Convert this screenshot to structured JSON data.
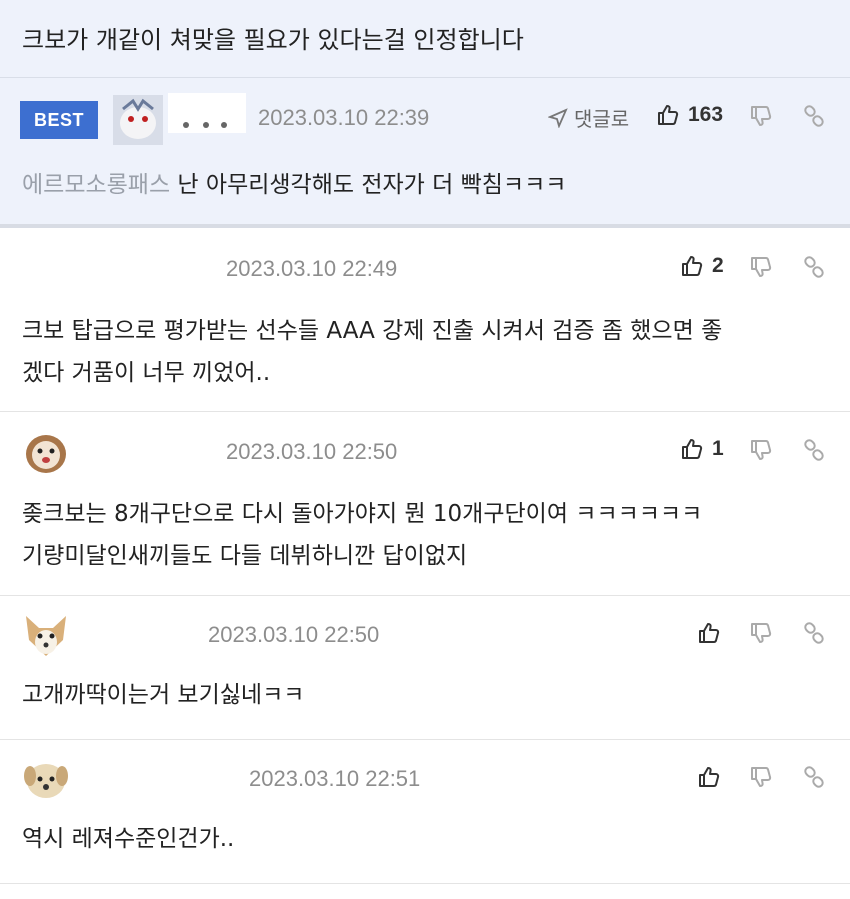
{
  "post_title": "크보가 개같이 쳐맞을 필요가 있다는걸 인정합니다",
  "best": {
    "badge": "BEST",
    "date": "2023.03.10 22:39",
    "reply_label": "댓글로",
    "likes": "163",
    "prefix": "에르모소롱패스",
    "text": " 난 아무리생각해도 전자가 더 빡침ㅋㅋㅋ"
  },
  "comments": [
    {
      "date": "2023.03.10 22:49",
      "likes": "2",
      "lines": [
        "크보 탑급으로 평가받는 선수들 AAA 강제 진출 시켜서 검증 좀 했으면 좋",
        "겠다 거품이 너무 끼었어.."
      ]
    },
    {
      "date": "2023.03.10 22:50",
      "likes": "1",
      "lines": [
        "좆크보는 8개구단으로 다시 돌아가야지 뭔 10개구단이여 ㅋㅋㅋㅋㅋㅋ",
        "기량미달인새끼들도 다들 데뷔하니깐 답이없지"
      ]
    },
    {
      "date": "2023.03.10 22:50",
      "likes": "",
      "lines": [
        "고개까딱이는거 보기싫네ㅋㅋ"
      ]
    },
    {
      "date": "2023.03.10 22:51",
      "likes": "",
      "lines": [
        "역시 레져수준인건가.."
      ]
    }
  ]
}
